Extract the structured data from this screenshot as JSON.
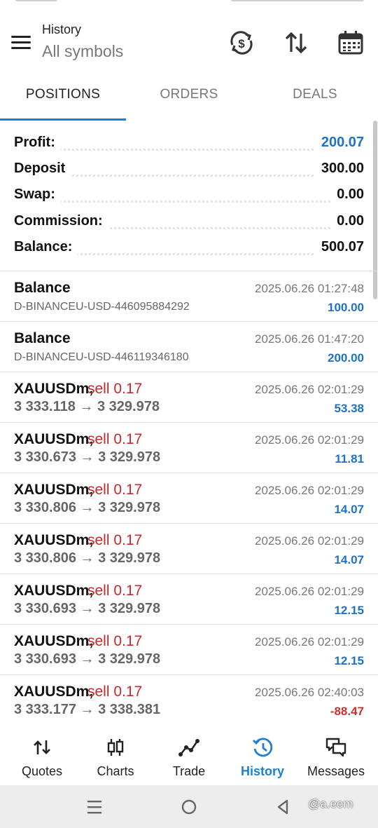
{
  "header": {
    "title": "History",
    "subtitle": "All symbols",
    "icons": [
      "currency-exchange-icon",
      "sort-icon",
      "calendar-icon"
    ]
  },
  "tabs": [
    {
      "label": "POSITIONS",
      "active": true
    },
    {
      "label": "ORDERS",
      "active": false
    },
    {
      "label": "DEALS",
      "active": false
    }
  ],
  "summary": [
    {
      "label": "Profit:",
      "value": "200.07",
      "highlight": true
    },
    {
      "label": "Deposit",
      "value": "300.00"
    },
    {
      "label": "Swap:",
      "value": "0.00"
    },
    {
      "label": "Commission:",
      "value": "0.00"
    },
    {
      "label": "Balance:",
      "value": "500.07"
    }
  ],
  "balance_entries": [
    {
      "title": "Balance",
      "account": "D-BINANCEU-USD-446095884292",
      "datetime": "2025.06.26 01:27:48",
      "amount": "100.00"
    },
    {
      "title": "Balance",
      "account": "D-BINANCEU-USD-446119346180",
      "datetime": "2025.06.26 01:47:20",
      "amount": "200.00"
    }
  ],
  "positions": [
    {
      "symbol": "XAUUSDm,",
      "side": "sell 0.17",
      "prices": "3 333.118 → 3 329.978",
      "datetime": "2025.06.26 02:01:29",
      "profit": "53.38"
    },
    {
      "symbol": "XAUUSDm,",
      "side": "sell 0.17",
      "prices": "3 330.673 → 3 329.978",
      "datetime": "2025.06.26 02:01:29",
      "profit": "11.81"
    },
    {
      "symbol": "XAUUSDm,",
      "side": "sell 0.17",
      "prices": "3 330.806 → 3 329.978",
      "datetime": "2025.06.26 02:01:29",
      "profit": "14.07"
    },
    {
      "symbol": "XAUUSDm,",
      "side": "sell 0.17",
      "prices": "3 330.806 → 3 329.978",
      "datetime": "2025.06.26 02:01:29",
      "profit": "14.07"
    },
    {
      "symbol": "XAUUSDm,",
      "side": "sell 0.17",
      "prices": "3 330.693 → 3 329.978",
      "datetime": "2025.06.26 02:01:29",
      "profit": "12.15"
    },
    {
      "symbol": "XAUUSDm,",
      "side": "sell 0.17",
      "prices": "3 330.693 → 3 329.978",
      "datetime": "2025.06.26 02:01:29",
      "profit": "12.15"
    },
    {
      "symbol": "XAUUSDm,",
      "side": "sell 0.17",
      "prices": "3 333.177 → 3 338.381",
      "datetime": "2025.06.26 02:40:03",
      "profit": "-88.47",
      "negative": true
    }
  ],
  "bottom_nav": [
    {
      "label": "Quotes",
      "icon": "quotes-arrows-icon"
    },
    {
      "label": "Charts",
      "icon": "candlestick-icon"
    },
    {
      "label": "Trade",
      "icon": "trade-line-icon"
    },
    {
      "label": "History",
      "icon": "history-clock-icon",
      "active": true
    },
    {
      "label": "Messages",
      "icon": "messages-icon"
    }
  ],
  "system_bar": {
    "watermark": "@a.eem"
  },
  "colors": {
    "accent": "#1e7ed4",
    "profit_blue": "#1e72c7",
    "sell_red": "#c62828",
    "loss_red": "#d32f2f"
  }
}
